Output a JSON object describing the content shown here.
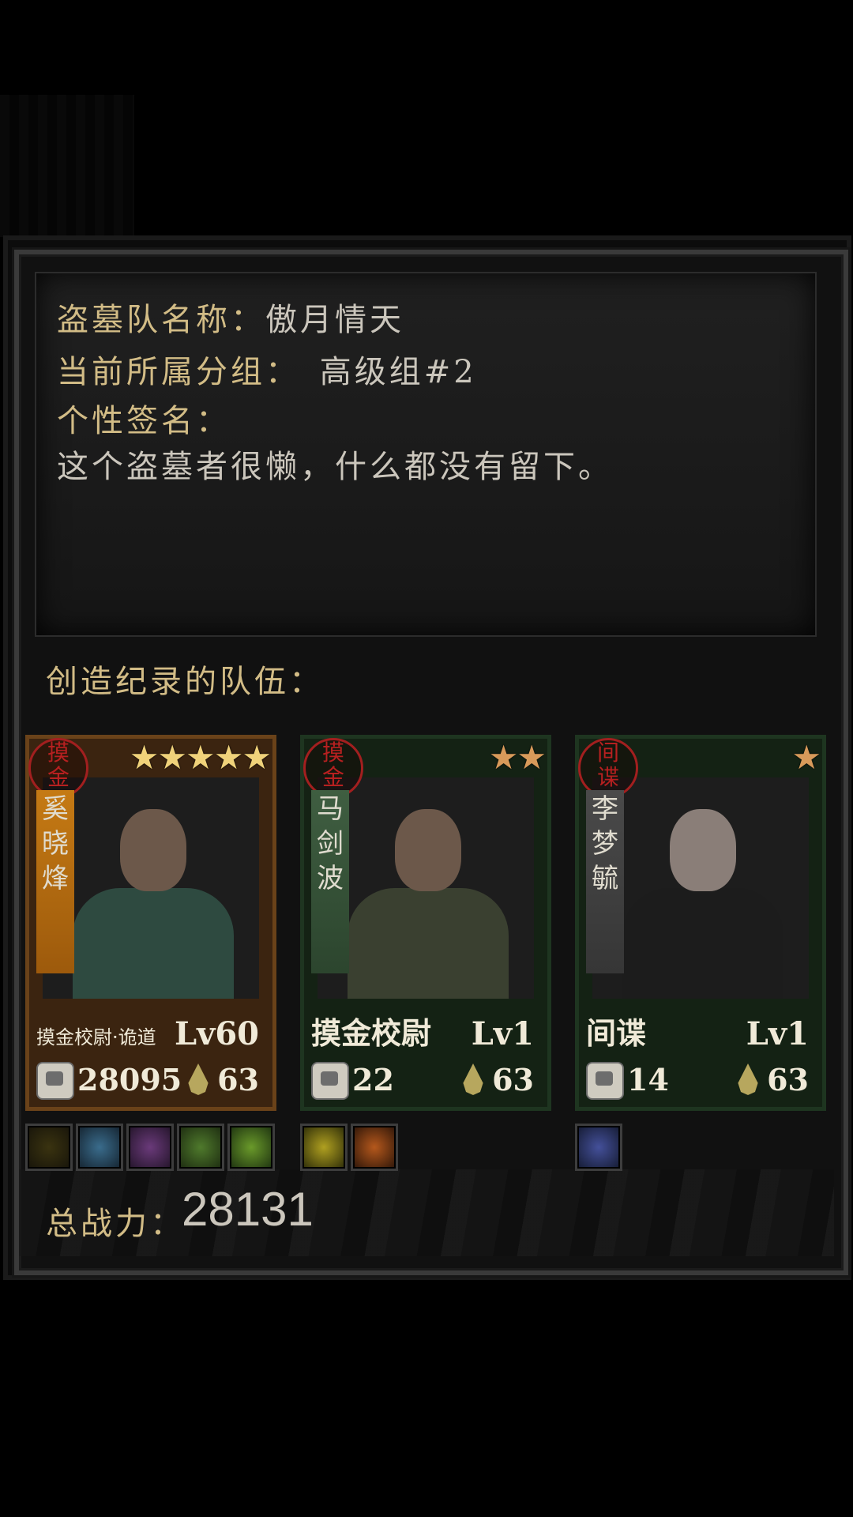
{
  "team": {
    "name_label": "盗墓队名称：",
    "name_value": "傲月情天",
    "group_label": "当前所属分组：",
    "group_value": "高级组#2",
    "signature_label": "个性签名：",
    "signature_value": "这个盗墓者很懒，什么都没有留下。"
  },
  "records_title": "创造纪录的队伍：",
  "members": [
    {
      "badge": [
        "摸",
        "金"
      ],
      "name": [
        "奚",
        "晓",
        "烽"
      ],
      "stars": "★★★★★",
      "class_name": "摸金校尉·诡道",
      "level": "Lv60",
      "power": "28095",
      "stamina": "63",
      "frame_color": "#6a4219",
      "banner_color": "orange"
    },
    {
      "badge": [
        "摸",
        "金"
      ],
      "name": [
        "马",
        "剑",
        "波"
      ],
      "stars": "★★",
      "class_name": "摸金校尉",
      "level": "Lv1",
      "power": "22",
      "stamina": "63",
      "frame_color": "#1e3520",
      "banner_color": "green"
    },
    {
      "badge": [
        "间",
        "谍"
      ],
      "name": [
        "李",
        "梦",
        "毓"
      ],
      "stars": "★",
      "class_name": "间谍",
      "level": "Lv1",
      "power": "14",
      "stamina": "63",
      "frame_color": "#1e3520",
      "banner_color": "gray"
    }
  ],
  "skills": {
    "member1": [
      "shadow-face-icon",
      "blue-totem-icon",
      "purple-beast-icon",
      "green-armor-icon",
      "green-figure-icon"
    ],
    "member2": [
      "crossed-blades-icon",
      "fire-pot-icon"
    ],
    "member3": [
      "blue-figure-icon"
    ]
  },
  "total": {
    "label": "总战力：",
    "value": "28131"
  },
  "colors": {
    "gold_text": "#d2bc86",
    "light_text": "#cbc6bc",
    "badge_red": "#b72020"
  }
}
